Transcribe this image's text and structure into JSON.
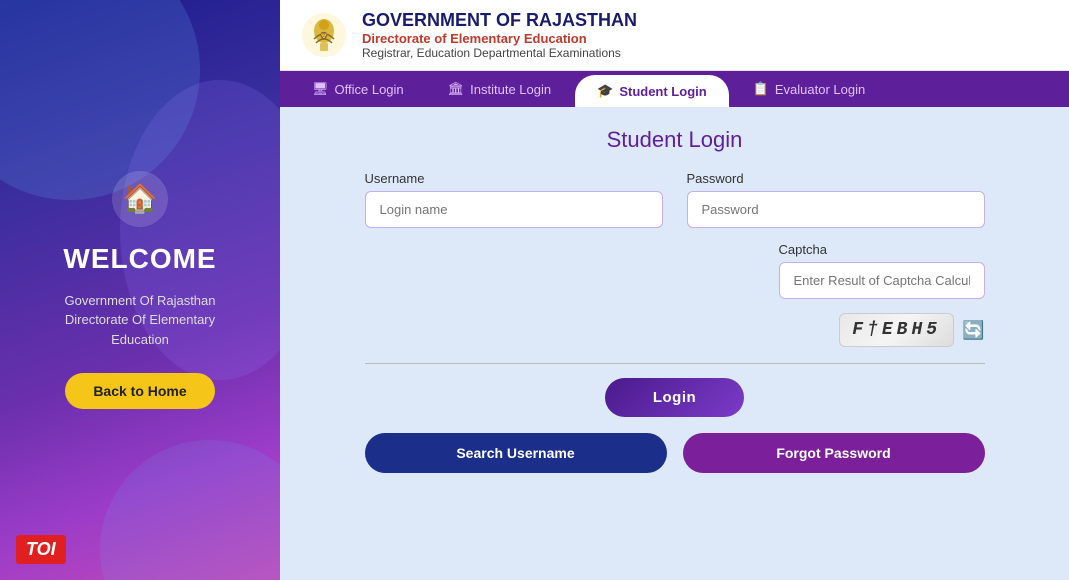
{
  "sidebar": {
    "home_icon": "🏠",
    "welcome": "WELCOME",
    "desc_line1": "Government Of Rajasthan",
    "desc_line2": "Directorate Of Elementary",
    "desc_line3": "Education",
    "back_home_label": "Back to Home",
    "toi_label": "TOI"
  },
  "header": {
    "title": "GOVERNMENT OF RAJASTHAN",
    "subtitle": "Directorate of Elementary Education",
    "sub2": "Registrar, Education Departmental Examinations"
  },
  "nav": {
    "tabs": [
      {
        "id": "office",
        "label": "Office Login",
        "icon": "🖥",
        "active": false
      },
      {
        "id": "institute",
        "label": "Institute Login",
        "icon": "🏛",
        "active": false
      },
      {
        "id": "student",
        "label": "Student Login",
        "icon": "🎓",
        "active": true
      },
      {
        "id": "evaluator",
        "label": "Evaluator Login",
        "icon": "📋",
        "active": false
      }
    ]
  },
  "form": {
    "title": "Student Login",
    "username_label": "Username",
    "username_placeholder": "Login name",
    "password_label": "Password",
    "password_placeholder": "Password",
    "captcha_label": "Captcha",
    "captcha_placeholder": "Enter Result of Captcha Calculation",
    "captcha_text": "F†EBH5",
    "login_btn": "Login",
    "search_username_btn": "Search Username",
    "forgot_password_btn": "Forgot Password"
  },
  "colors": {
    "accent_purple": "#5e1f9a",
    "accent_dark_blue": "#1a2e8a",
    "nav_bg": "#5e1f9a",
    "tab_active_text": "#5e1f9a"
  }
}
